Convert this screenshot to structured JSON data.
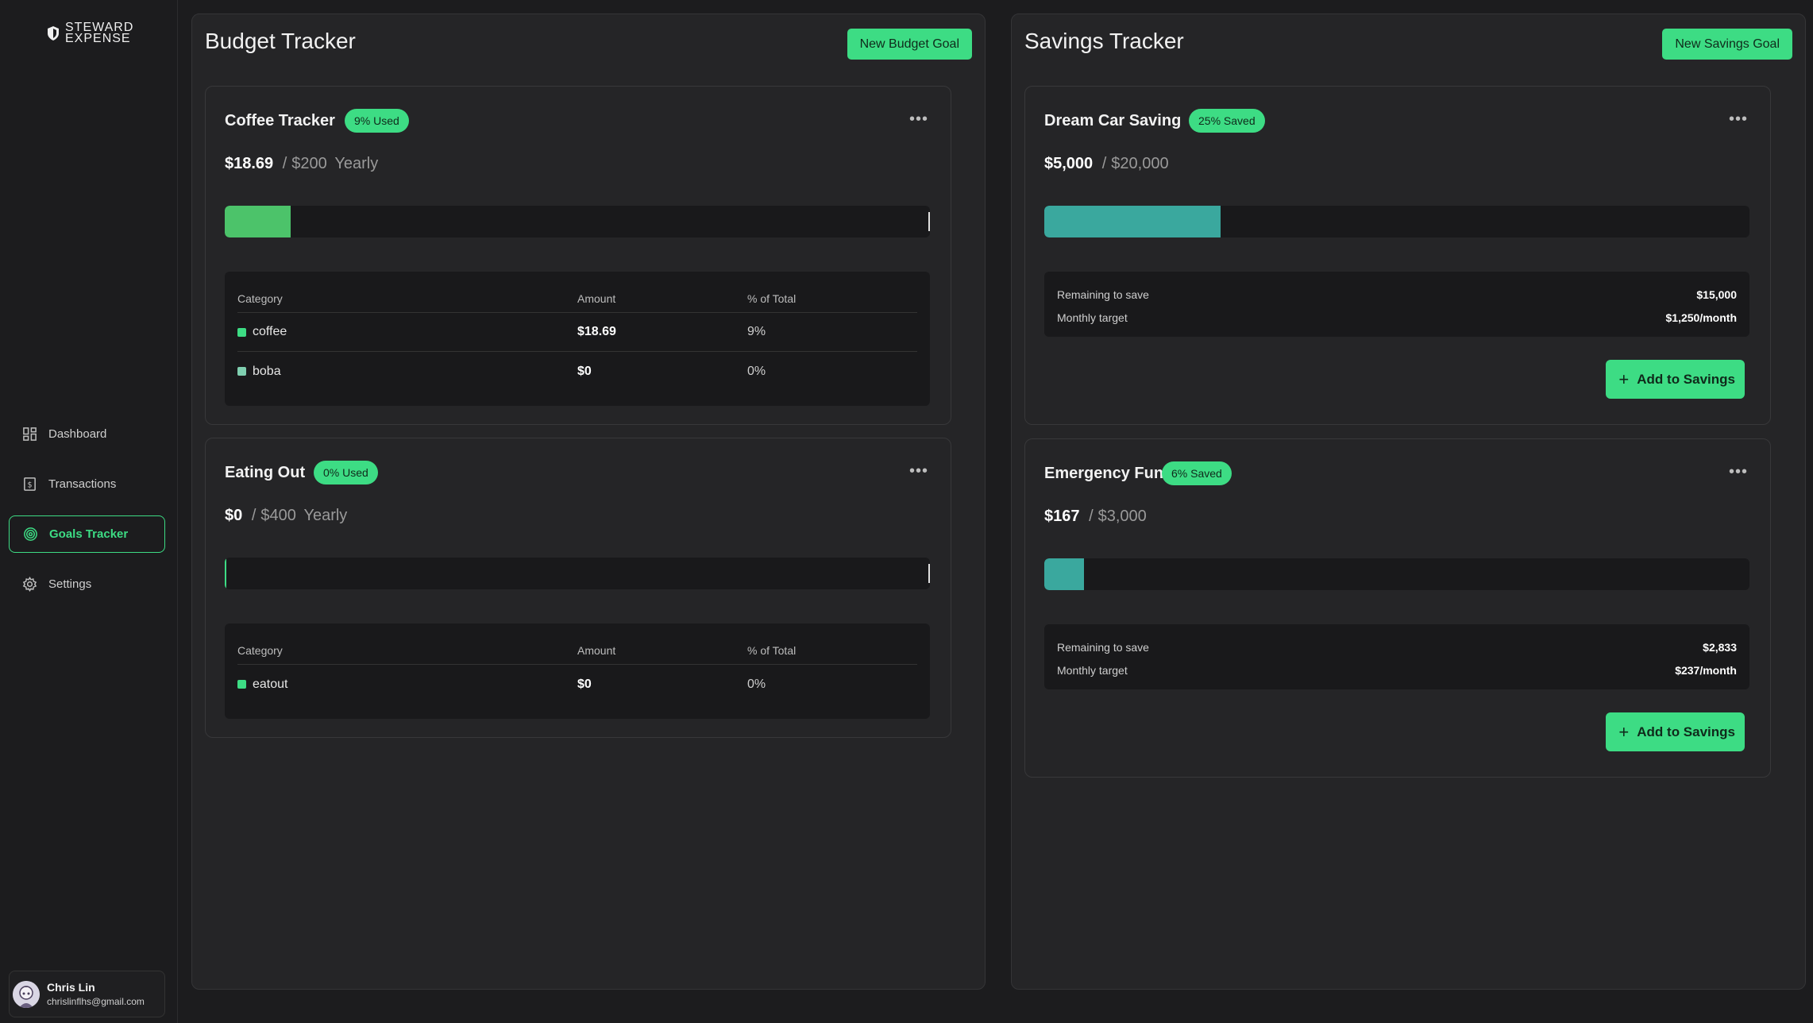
{
  "app": {
    "logo_line1": "STEWARD",
    "logo_line2": "EXPENSE"
  },
  "sidebar": {
    "items": [
      {
        "label": "Dashboard",
        "icon": "dashboard-icon"
      },
      {
        "label": "Transactions",
        "icon": "receipt-icon"
      },
      {
        "label": "Goals Tracker",
        "icon": "target-icon",
        "active": true
      },
      {
        "label": "Settings",
        "icon": "gear-icon"
      }
    ],
    "user": {
      "name": "Chris Lin",
      "email": "chrislinflhs@gmail.com"
    }
  },
  "colors": {
    "accent": "#3ddc84",
    "budget_fill": "#4cc36a",
    "savings_fill": "#3aa89e",
    "coffee_dot": "#3ddc84",
    "boba_dot": "#7fcfb0"
  },
  "budget": {
    "title": "Budget Tracker",
    "new_button": "New Budget Goal",
    "table_headers": {
      "category": "Category",
      "amount": "Amount",
      "percent": "% of Total"
    },
    "cards": [
      {
        "title": "Coffee Tracker",
        "badge": "9% Used",
        "current": "$18.69",
        "separator": "/",
        "limit": "$200",
        "period": "Yearly",
        "progress": 0.0935,
        "rows": [
          {
            "category": "coffee",
            "amount": "$18.69",
            "percent": "9%"
          },
          {
            "category": "boba",
            "amount": "$0",
            "percent": "0%"
          }
        ]
      },
      {
        "title": "Eating Out",
        "badge": "0% Used",
        "current": "$0",
        "separator": "/",
        "limit": "$400",
        "period": "Yearly",
        "progress": 0,
        "rows": [
          {
            "category": "eatout",
            "amount": "$0",
            "percent": "0%"
          }
        ]
      }
    ]
  },
  "savings": {
    "title": "Savings Tracker",
    "new_button": "New Savings Goal",
    "add_label": "Add to Savings",
    "remaining_label": "Remaining to save",
    "monthly_label": "Monthly target",
    "cards": [
      {
        "title": "Dream Car Saving",
        "badge": "25% Saved",
        "current": "$5,000",
        "separator": "/",
        "target": "$20,000",
        "progress": 0.25,
        "remaining": "$15,000",
        "monthly": "$1,250/month"
      },
      {
        "title": "Emergency Fund",
        "badge": "6% Saved",
        "current": "$167",
        "separator": "/",
        "target": "$3,000",
        "progress": 0.056,
        "remaining": "$2,833",
        "monthly": "$237/month"
      }
    ]
  }
}
